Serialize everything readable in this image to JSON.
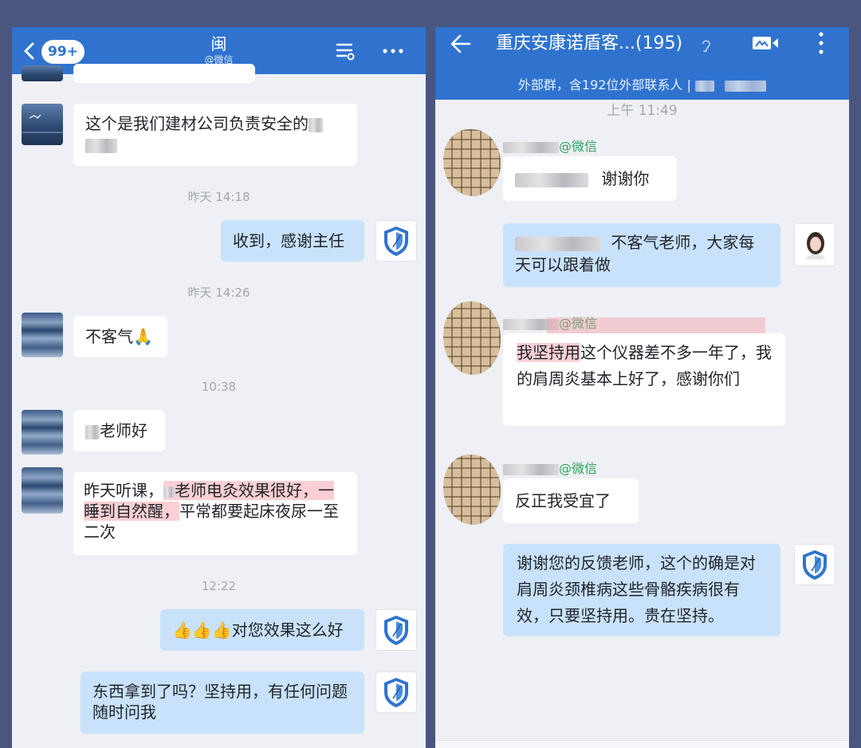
{
  "left": {
    "header": {
      "badge": "99+",
      "title": "闽",
      "subtitle": "@微信",
      "icons": [
        "chevron-left-icon",
        "list-filter-icon",
        "more-horizontal-icon"
      ]
    },
    "messages": [
      {
        "type": "in",
        "text": "这个是我们建材公司负责安全的"
      },
      {
        "type": "time",
        "text": "昨天 14:18"
      },
      {
        "type": "out",
        "text": "收到，感谢主任"
      },
      {
        "type": "time",
        "text": "昨天 14:26"
      },
      {
        "type": "in",
        "text": "不客气",
        "emoji": "🙏"
      },
      {
        "type": "time",
        "text": "10:38"
      },
      {
        "type": "in",
        "text": "老师好"
      },
      {
        "type": "in",
        "parts": [
          "昨天听课，",
          "老师电灸效果很好，",
          "一睡到自然醒，",
          "平常都要起床夜尿一至二次"
        ]
      },
      {
        "type": "time",
        "text": "12:22"
      },
      {
        "type": "out",
        "emoji": "👍👍👍",
        "text": "对您效果这么好"
      },
      {
        "type": "out",
        "text": "东西拿到了吗？坚持用，有任何问题随时问我"
      }
    ]
  },
  "right": {
    "header": {
      "title": "重庆安康诺盾客...(195)",
      "subbar": "外部群，含192位外部联系人 |",
      "icons": [
        "arrow-left-icon",
        "ear-icon",
        "video-call-icon",
        "more-vertical-icon"
      ]
    },
    "messages": [
      {
        "type": "time",
        "text": "上午 11:49"
      },
      {
        "type": "in",
        "sender_suffix": "@微信",
        "text": "谢谢你"
      },
      {
        "type": "out",
        "text": "不客气老师，大家每天可以跟着做"
      },
      {
        "type": "in",
        "sender_suffix": "@微信",
        "parts": [
          "我坚持用",
          "这个仪器差不多一年了，我的肩周炎基本上好了，感谢你们"
        ]
      },
      {
        "type": "in",
        "sender_suffix": "@微信",
        "text": "反正我受宜了"
      },
      {
        "type": "out",
        "text": "谢谢您的反馈老师，这个的确是对肩周炎颈椎病这些骨骼疾病很有效，只要坚持用。贵在坚持。"
      }
    ]
  },
  "colors": {
    "header": "#2f73cf",
    "incoming": "#ffffff",
    "outgoing": "#c9e2fb",
    "highlight": "#f696a0",
    "wechat_green": "#2fa35a"
  }
}
